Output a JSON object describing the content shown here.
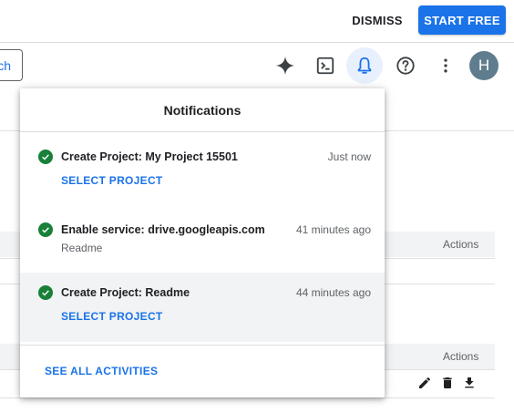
{
  "promo": {
    "dismiss_label": "DISMISS",
    "start_label": "START FREE"
  },
  "toolbar": {
    "search_fragment": "ch",
    "avatar_letter": "H",
    "icons": [
      "gemini-sparkle-icon",
      "cloud-shell-icon",
      "notifications-bell-icon",
      "help-icon",
      "more-vert-icon"
    ]
  },
  "background": {
    "actions_header_1": "Actions",
    "actions_header_2": "Actions"
  },
  "notifications": {
    "title": "Notifications",
    "items": [
      {
        "title": "Create Project: My Project 15501",
        "time": "Just now",
        "link": "SELECT PROJECT",
        "status": "success"
      },
      {
        "title": "Enable service: drive.googleapis.com",
        "time": "41 minutes ago",
        "subtitle": "Readme",
        "status": "success"
      },
      {
        "title": "Create Project: Readme",
        "time": "44 minutes ago",
        "link": "SELECT PROJECT",
        "status": "success"
      }
    ],
    "footer_link": "SEE ALL ACTIVITIES"
  },
  "colors": {
    "accent": "#1a73e8",
    "success": "#188038",
    "highlight_bg": "#f1f3f4",
    "active_icon_bg": "#e8f0fe"
  }
}
